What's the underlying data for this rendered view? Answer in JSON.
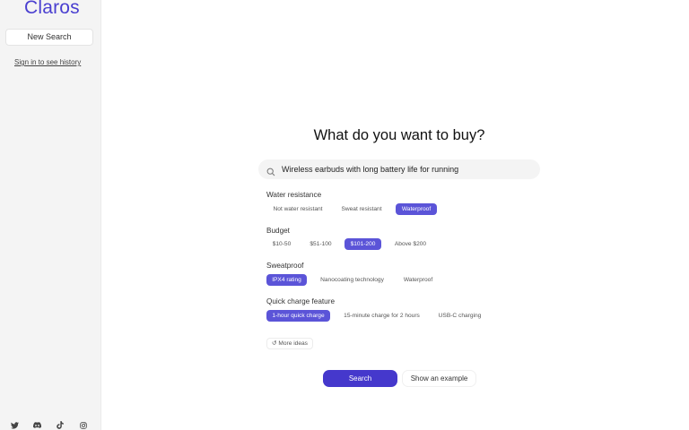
{
  "sidebar": {
    "logo": "Claros",
    "new_search": "New Search",
    "sign_in": "Sign in to see history",
    "social_icons": [
      "twitter-icon",
      "discord-icon",
      "tiktok-icon",
      "instagram-icon"
    ]
  },
  "main": {
    "heading": "What do you want to buy?",
    "search_query": "Wireless earbuds with long battery life for running",
    "groups": [
      {
        "label": "Water resistance",
        "options": [
          "Not water resistant",
          "Sweat resistant",
          "Waterproof"
        ],
        "selected": "Waterproof"
      },
      {
        "label": "Budget",
        "options": [
          "$10-50",
          "$51-100",
          "$101-200",
          "Above $200"
        ],
        "selected": "$101-200"
      },
      {
        "label": "Sweatproof",
        "options": [
          "IPX4 rating",
          "Nanocoating technology",
          "Waterproof"
        ],
        "selected": "IPX4 rating"
      },
      {
        "label": "Quick charge feature",
        "options": [
          "1-hour quick charge",
          "15-minute charge for 2 hours",
          "USB-C charging"
        ],
        "selected": "1-hour quick charge"
      }
    ],
    "more_ideas": "↺ More ideas",
    "search_button": "Search",
    "example_button": "Show an example"
  },
  "colors": {
    "accent": "#5b54d8",
    "primary_button": "#4538cc",
    "logo": "#4a3fd0"
  }
}
